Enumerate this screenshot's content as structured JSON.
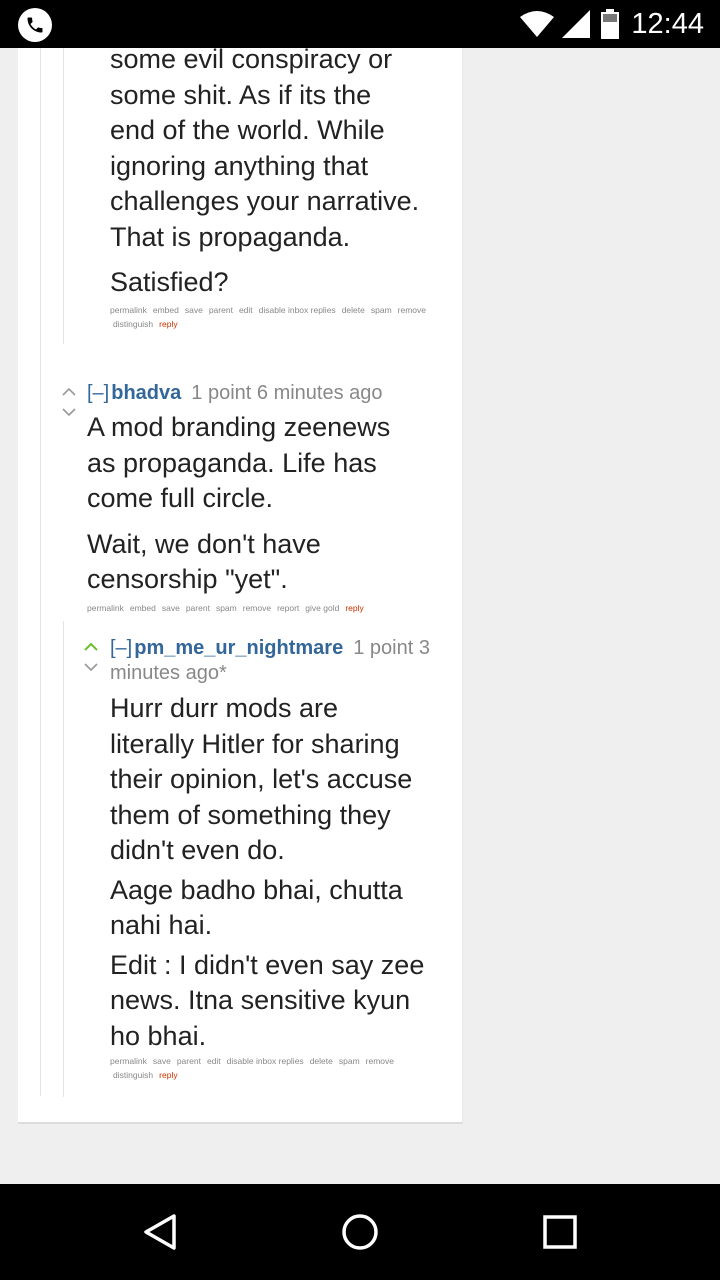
{
  "status_bar": {
    "time": "12:44"
  },
  "comment_top": {
    "paragraphs": [
      "some evil conspiracy or\nsome shit. As if its the\nend of the world. While\nignoring anything that\nchallenges your narrative.\nThat is propaganda.",
      "Satisfied?"
    ],
    "buttons": [
      "permalink",
      "embed",
      "save",
      "parent",
      "edit",
      "disable inbox replies",
      "delete",
      "spam",
      "remove",
      "distinguish"
    ],
    "reply": "reply"
  },
  "comment_bhadva": {
    "collapse": "[–]",
    "author": "bhadva",
    "meta": "1 point 6 minutes ago",
    "paragraphs": [
      "A mod branding zeenews\nas propaganda. Life has\ncome full circle.",
      "Wait, we don't have\ncensorship \"yet\"."
    ],
    "buttons": [
      "permalink",
      "embed",
      "save",
      "parent",
      "spam",
      "remove",
      "report",
      "give gold"
    ],
    "reply": "reply"
  },
  "comment_pm": {
    "collapse": "[–]",
    "author": "pm_me_ur_nightmare",
    "meta_line1": "1 point 3",
    "meta_line2": "minutes ago*",
    "paragraphs": [
      "Hurr durr mods are\nliterally Hitler for sharing\ntheir opinion, let's accuse\nthem of something they\ndidn't even do.",
      "Aage badho bhai, chutta\nnahi hai.",
      "Edit : I didn't even say zee\nnews. Itna sensitive kyun\nho bhai."
    ],
    "buttons": [
      "permalink",
      "save",
      "parent",
      "edit",
      "disable inbox replies",
      "delete",
      "spam",
      "remove",
      "distinguish"
    ],
    "reply": "reply"
  },
  "colors": {
    "upvoted": "#6bbf2c",
    "author": "#336699",
    "reply": "#cc3300"
  }
}
